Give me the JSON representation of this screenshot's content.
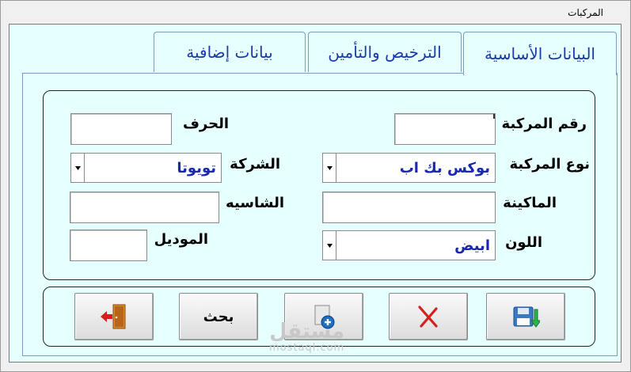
{
  "window": {
    "title": "المركبات"
  },
  "tabs": [
    {
      "label": "البيانات الأساسية",
      "active": true
    },
    {
      "label": "الترخيص والتأمين",
      "active": false
    },
    {
      "label": "بيانات إضافية",
      "active": false
    }
  ],
  "fields": {
    "vehicle_number": {
      "label": "رقم المركبة",
      "value": ""
    },
    "letter": {
      "label": "الحرف",
      "value": ""
    },
    "vehicle_type": {
      "label": "نوع المركبة",
      "value": "بوكس بك اب"
    },
    "company": {
      "label": "الشركة",
      "value": "تويوتا"
    },
    "engine": {
      "label": "الماكينة",
      "value": ""
    },
    "chassis": {
      "label": "الشاسيه",
      "value": ""
    },
    "color": {
      "label": "اللون",
      "value": "ابيض"
    },
    "model": {
      "label": "الموديل",
      "value": ""
    }
  },
  "buttons": {
    "search_label": "بحث"
  },
  "watermark": {
    "brand": "مستقل",
    "site": "mostaql.com"
  },
  "colors": {
    "panel_bg": "#e6ffff",
    "tab_text": "#1a3aa8",
    "value_text": "#1a28b0"
  }
}
